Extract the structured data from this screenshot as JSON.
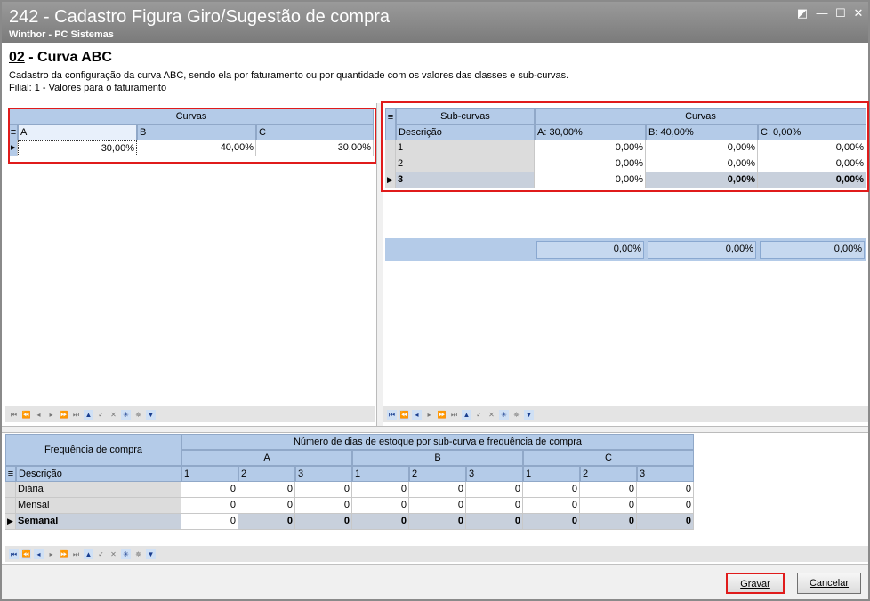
{
  "window": {
    "title": "242 - Cadastro Figura Giro/Sugestão de compra",
    "subtitle": "Winthor - PC Sistemas"
  },
  "page": {
    "heading_num": "02",
    "heading_text": " - Curva ABC",
    "description": "Cadastro da configuração da curva ABC, sendo ela por faturamento ou por quantidade com os valores das classes e sub-curvas.",
    "filial": "Filial: 1 - Valores para o faturamento"
  },
  "curvas": {
    "group": "Curvas",
    "cols": [
      "A",
      "B",
      "C"
    ],
    "row": [
      "30,00%",
      "40,00%",
      "30,00%"
    ]
  },
  "subcurvas": {
    "group1": "Sub-curvas",
    "group2": "Curvas",
    "cols": [
      "Descrição",
      "A: 30,00%",
      "B: 40,00%",
      "C: 0,00%"
    ],
    "rows": [
      [
        "1",
        "0,00%",
        "0,00%",
        "0,00%"
      ],
      [
        "2",
        "0,00%",
        "0,00%",
        "0,00%"
      ],
      [
        "3",
        "0,00%",
        "0,00%",
        "0,00%"
      ]
    ],
    "totals": [
      "0,00%",
      "0,00%",
      "0,00%"
    ]
  },
  "freq": {
    "corner": "Frequência de compra",
    "group": "Número de dias de estoque por sub-curva e frequência de compra",
    "classes": [
      "A",
      "B",
      "C"
    ],
    "sub": [
      "1",
      "2",
      "3",
      "1",
      "2",
      "3",
      "1",
      "2",
      "3"
    ],
    "desc_col": "Descrição",
    "rows": [
      {
        "label": "Diária",
        "values": [
          "0",
          "0",
          "0",
          "0",
          "0",
          "0",
          "0",
          "0",
          "0"
        ]
      },
      {
        "label": "Mensal",
        "values": [
          "0",
          "0",
          "0",
          "0",
          "0",
          "0",
          "0",
          "0",
          "0"
        ]
      },
      {
        "label": "Semanal",
        "values": [
          "0",
          "0",
          "0",
          "0",
          "0",
          "0",
          "0",
          "0",
          "0"
        ]
      }
    ]
  },
  "buttons": {
    "save": "Gravar",
    "cancel": "Cancelar"
  }
}
